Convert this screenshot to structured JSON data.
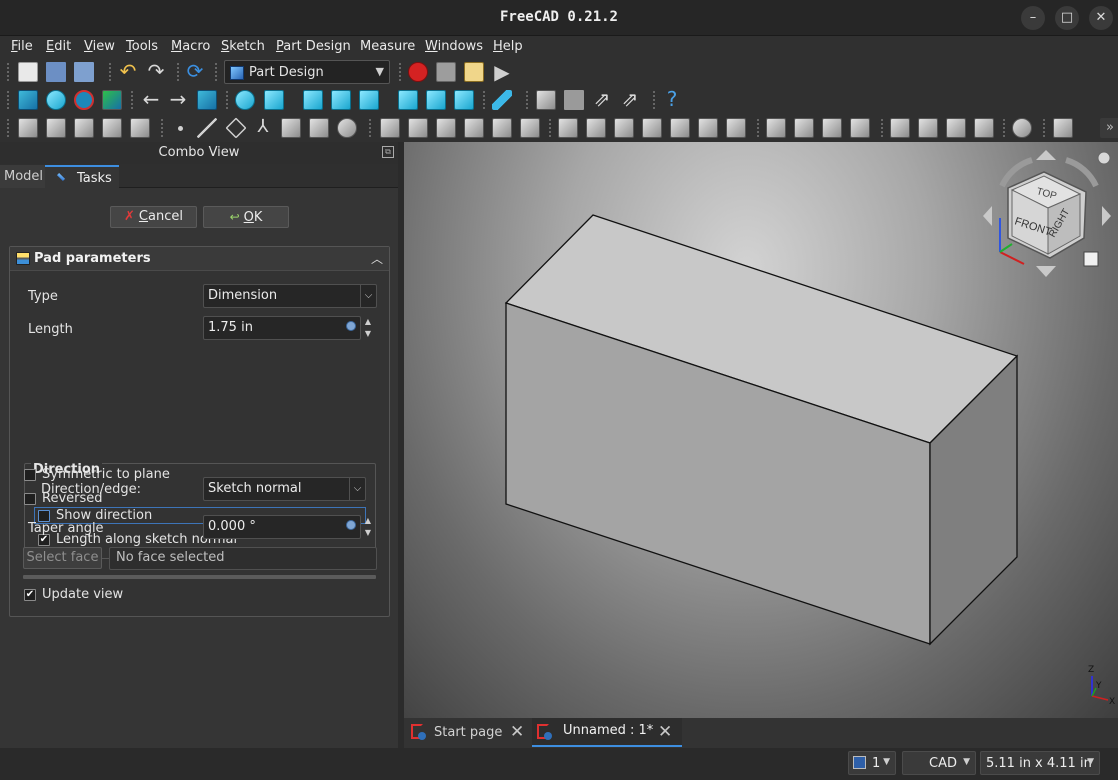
{
  "window": {
    "title": "FreeCAD 0.21.2",
    "minimize": "–",
    "maximize": "□",
    "close": "✕"
  },
  "menu": [
    {
      "key": "F",
      "rest": "ile"
    },
    {
      "key": "E",
      "rest": "dit"
    },
    {
      "key": "V",
      "rest": "iew"
    },
    {
      "key": "T",
      "rest": "ools"
    },
    {
      "key": "M",
      "rest": "acro"
    },
    {
      "key": "S",
      "rest": "ketch"
    },
    {
      "key": "P",
      "rest": "art Design"
    },
    {
      "key": "",
      "rest": "Measure"
    },
    {
      "key": "W",
      "rest": "indows"
    },
    {
      "key": "H",
      "rest": "elp"
    }
  ],
  "toolbar": {
    "workbench": "Part Design",
    "overflow": "»"
  },
  "combo_view": {
    "title": "Combo View",
    "tabs": {
      "model": "Model",
      "tasks": "Tasks"
    },
    "cancel": {
      "key": "C",
      "rest": "ancel"
    },
    "ok": {
      "key": "O",
      "rest": "K"
    }
  },
  "pad": {
    "header": "Pad parameters",
    "type_label": "Type",
    "type_value": "Dimension",
    "length_label": "Length",
    "length_value": "1.75 in",
    "direction_title": "Direction",
    "direction_edge_label": "Direction/edge:",
    "direction_edge_value": "Sketch normal",
    "show_direction": {
      "label": "Show direction",
      "checked": false
    },
    "length_along_normal": {
      "label": "Length along sketch normal",
      "checked": true
    },
    "symmetric": {
      "label": "Symmetric to plane",
      "checked": false
    },
    "reversed": {
      "label": "Reversed",
      "checked": false
    },
    "taper_label": "Taper angle",
    "taper_value": "0.000 °",
    "select_face_button": "Select face",
    "face_value": "No face selected",
    "update_view": {
      "label": "Update view",
      "checked": true
    }
  },
  "navcube": {
    "top": "TOP",
    "front": "FRONT",
    "right": "RIGHT"
  },
  "axes": {
    "x": "X",
    "y": "Y",
    "z": "Z"
  },
  "doc_tabs": [
    {
      "label": "Start page",
      "active": false
    },
    {
      "label": "Unnamed : 1*",
      "active": true
    }
  ],
  "status": {
    "view_count": "1",
    "nav_style": "CAD",
    "dimensions": "5.11 in x 4.11 in"
  }
}
